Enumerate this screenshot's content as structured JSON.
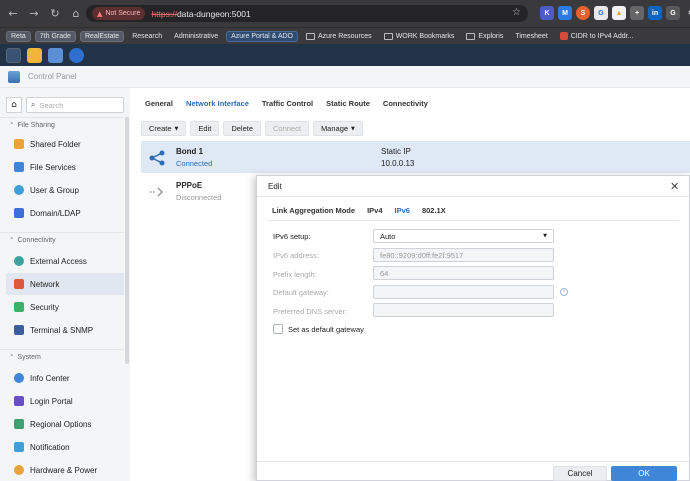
{
  "browser": {
    "not_secure": "Not Secure",
    "url_scheme": "https://",
    "url_rest": "data-dungeon:5001",
    "bookmarks": [
      "Reta",
      "7th Grade",
      "RealEstate",
      "Research",
      "Administrative",
      "Azure Portal & ADO",
      "Azure Resources",
      "WORK Bookmarks",
      "Exploris",
      "Timesheet",
      "CIDR to IPv4 Addr..."
    ]
  },
  "app": {
    "title": "Control Panel"
  },
  "sidebar": {
    "search_placeholder": "Search",
    "sections": [
      {
        "label": "File Sharing"
      },
      {
        "label": "Connectivity"
      },
      {
        "label": "System"
      }
    ],
    "items": [
      {
        "label": "Shared Folder",
        "icon": "folder-icon",
        "color": "#e8a33a"
      },
      {
        "label": "File Services",
        "icon": "file-services-icon",
        "color": "#3f86d9"
      },
      {
        "label": "User & Group",
        "icon": "users-icon",
        "color": "#3fa0d9"
      },
      {
        "label": "Domain/LDAP",
        "icon": "domain-icon",
        "color": "#3f6fd9"
      },
      {
        "label": "External Access",
        "icon": "globe-icon",
        "color": "#3fa0a0"
      },
      {
        "label": "Network",
        "icon": "network-house-icon",
        "color": "#d9583f"
      },
      {
        "label": "Security",
        "icon": "shield-icon",
        "color": "#3fb06a"
      },
      {
        "label": "Terminal & SNMP",
        "icon": "terminal-icon",
        "color": "#3a5f9c"
      },
      {
        "label": "Info Center",
        "icon": "info-icon",
        "color": "#3f86d9"
      },
      {
        "label": "Login Portal",
        "icon": "login-portal-icon",
        "color": "#6a4fc4"
      },
      {
        "label": "Regional Options",
        "icon": "regional-icon",
        "color": "#3fa070"
      },
      {
        "label": "Notification",
        "icon": "chat-icon",
        "color": "#3f9fd9"
      },
      {
        "label": "Hardware & Power",
        "icon": "bulb-icon",
        "color": "#e8a33a"
      }
    ]
  },
  "main": {
    "tabs": [
      "General",
      "Network Interface",
      "Traffic Control",
      "Static Route",
      "Connectivity"
    ],
    "active_tab": "Network Interface",
    "toolbar": {
      "create": "Create",
      "edit": "Edit",
      "delete": "Delete",
      "connect": "Connect",
      "manage": "Manage"
    },
    "interfaces": [
      {
        "name": "Bond 1",
        "status": "Connected",
        "type": "Static IP",
        "ip": "10.0.0.13"
      },
      {
        "name": "PPPoE",
        "status": "Disconnected",
        "type": "",
        "ip": ""
      }
    ]
  },
  "dialog": {
    "title": "Edit",
    "tabs": [
      "Link Aggregation Mode",
      "IPv4",
      "IPv6",
      "802.1X"
    ],
    "active_tab": "IPv6",
    "ipv6_setup_label": "IPv6 setup:",
    "ipv6_setup_value": "Auto",
    "ipv6_address_label": "IPv6 address:",
    "ipv6_address_value": "fe80::9209:d0ff:fe2f:9517",
    "prefix_label": "Prefix length:",
    "prefix_value": "64",
    "gateway_label": "Default gateway:",
    "gateway_value": "",
    "dns_label": "Preferred DNS server:",
    "dns_value": "",
    "default_gateway_checkbox": "Set as default gateway",
    "cancel": "Cancel",
    "ok": "OK"
  }
}
